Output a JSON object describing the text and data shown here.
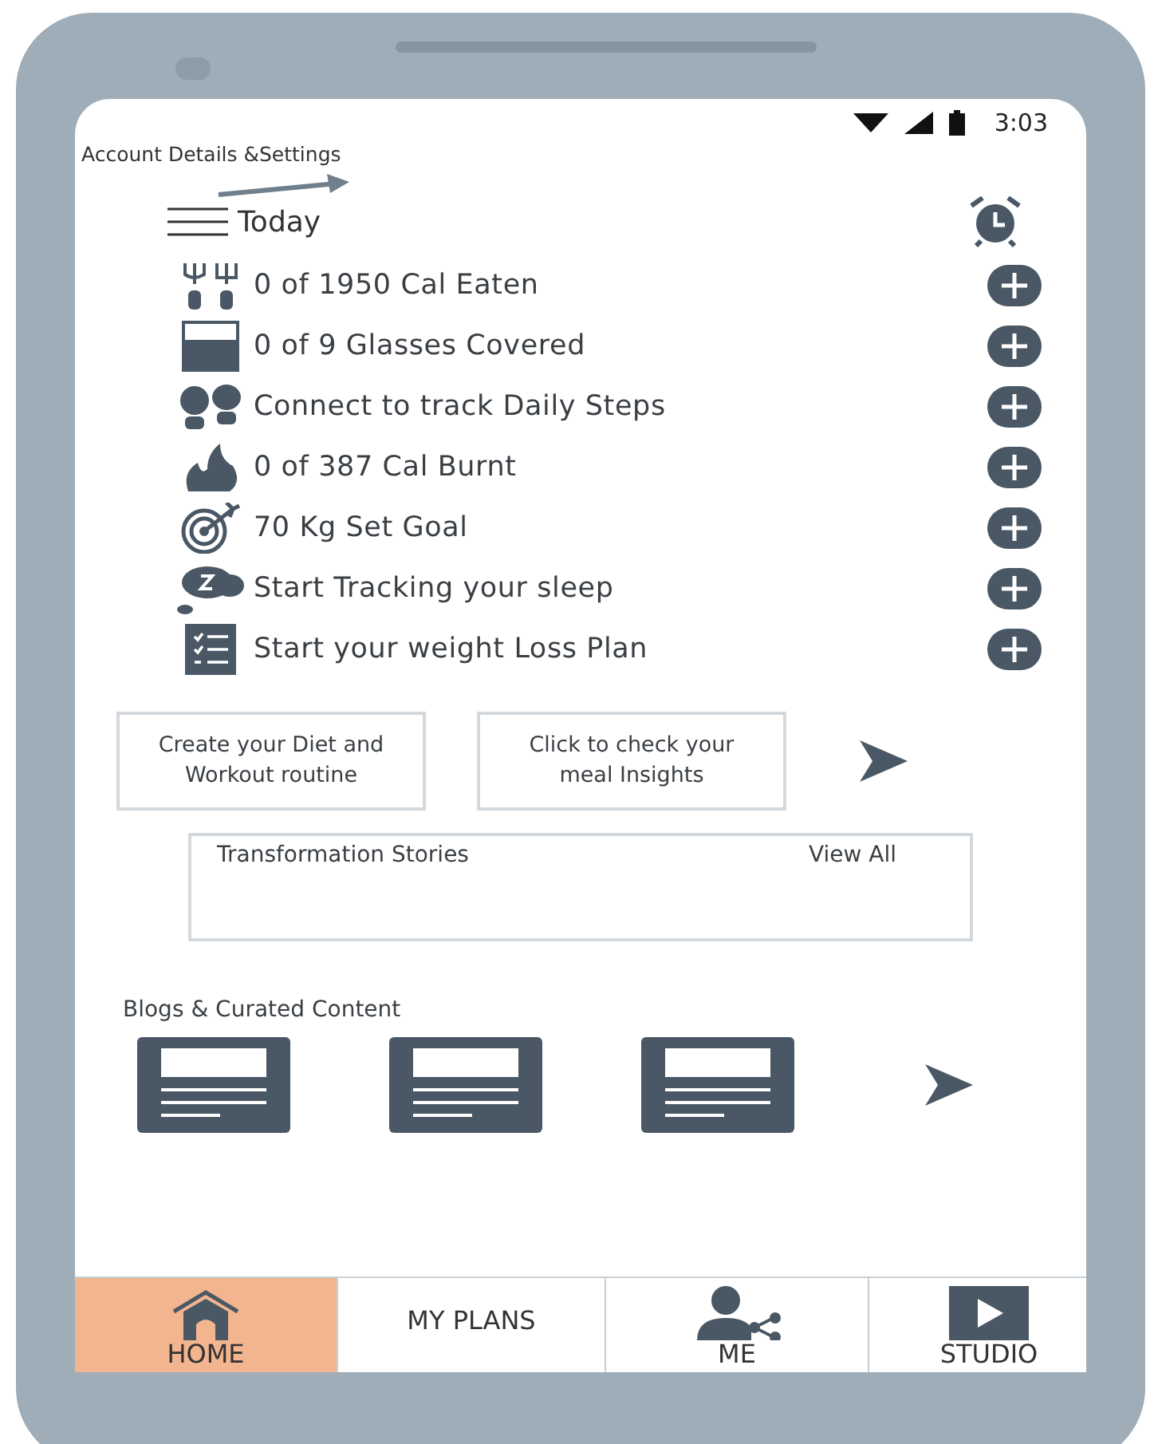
{
  "status_bar": {
    "time": "3:03"
  },
  "header": {
    "title": "Account Details &Settings",
    "page_title": "Today"
  },
  "trackers": [
    {
      "label": "0 of 1950 Cal Eaten"
    },
    {
      "label": "0 of 9 Glasses Covered"
    },
    {
      "label": "Connect to track Daily Steps"
    },
    {
      "label": "0 of 387 Cal Burnt"
    },
    {
      "label": "70 Kg Set Goal"
    },
    {
      "label": "Start Tracking your sleep"
    },
    {
      "label": "Start your weight Loss Plan"
    }
  ],
  "cards": [
    "Create your Diet and Workout routine",
    "Click to check your meal Insights"
  ],
  "stories": {
    "title": "Transformation Stories",
    "link": "View All"
  },
  "blogs": {
    "title": "Blogs & Curated Content"
  },
  "nav": [
    {
      "label": "HOME",
      "selected": true
    },
    {
      "label": "MY PLANS",
      "selected": false
    },
    {
      "label": "ME",
      "selected": false
    },
    {
      "label": "STUDIO",
      "selected": false
    }
  ]
}
